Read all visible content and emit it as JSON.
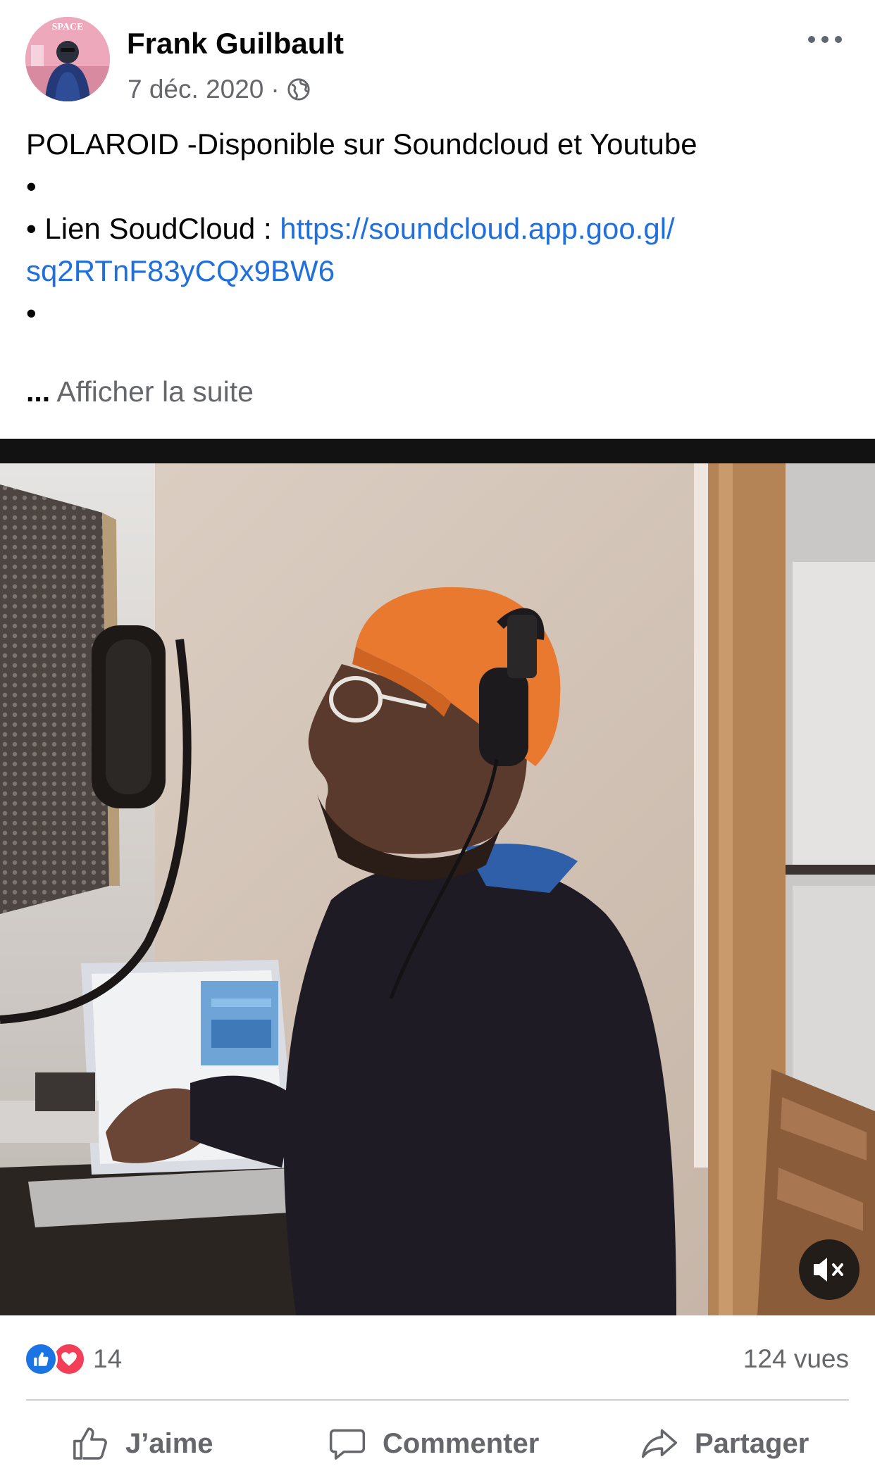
{
  "post": {
    "author": "Frank Guilbault",
    "date": "7 déc. 2020",
    "meta_separator": "·",
    "privacy_icon": "globe-icon",
    "more_icon": "more-options-icon",
    "avatar_text": "SPACE",
    "text_lines": {
      "line1": "POLAROID -Disponible sur Soundcloud et Youtube",
      "line2": "•",
      "line3_prefix": "• Lien SoudCloud : ",
      "line3_link": "https://soundcloud.app.goo.gl/",
      "line4_link": "sq2RTnF83yCQx9BW6",
      "line5": "•"
    },
    "see_more_ellipsis": "...",
    "see_more_label": "Afficher la suite"
  },
  "video": {
    "muted": true,
    "mute_icon": "speaker-muted-icon"
  },
  "stats": {
    "reaction_count": "14",
    "reaction_icons": [
      "like-reaction-icon",
      "love-reaction-icon"
    ],
    "views": "124 vues"
  },
  "actions": {
    "like_label": "J’aime",
    "comment_label": "Commenter",
    "share_label": "Partager"
  },
  "colors": {
    "link": "#216fdb",
    "secondary_text": "#65676b",
    "like_blue": "#1b74e4",
    "love_red": "#f33e58",
    "beanie_orange": "#e8792f"
  }
}
